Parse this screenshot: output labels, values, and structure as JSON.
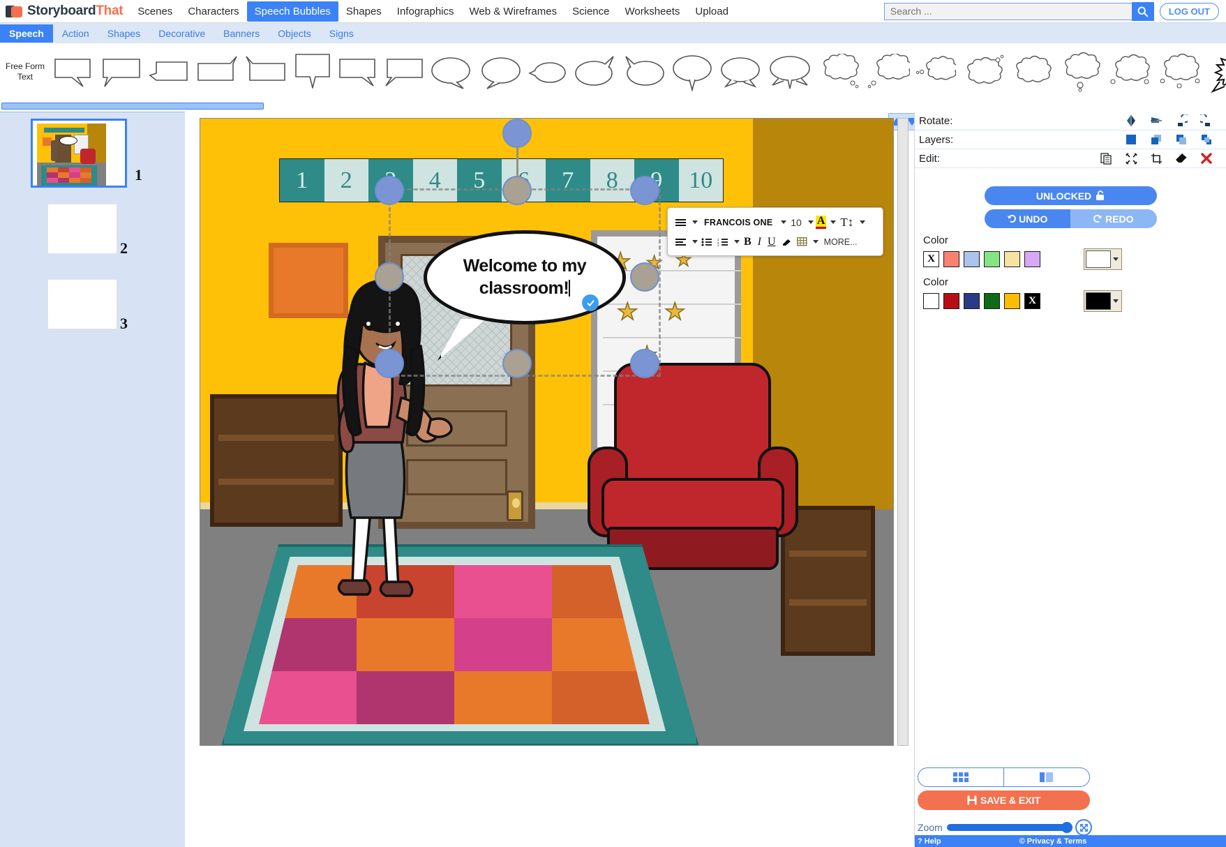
{
  "app": {
    "brand_part1": "Storyboard",
    "brand_part2": "That",
    "logo_icon": "storyboard-logo-icon"
  },
  "topnav": {
    "items": [
      {
        "label": "Scenes",
        "active": false
      },
      {
        "label": "Characters",
        "active": false
      },
      {
        "label": "Speech Bubbles",
        "active": true
      },
      {
        "label": "Shapes",
        "active": false
      },
      {
        "label": "Infographics",
        "active": false
      },
      {
        "label": "Web & Wireframes",
        "active": false
      },
      {
        "label": "Science",
        "active": false
      },
      {
        "label": "Worksheets",
        "active": false
      },
      {
        "label": "Upload",
        "active": false
      }
    ],
    "search_placeholder": "Search ...",
    "search_value": "",
    "search_icon": "search-icon",
    "logout_label": "LOG OUT",
    "active_accent": "#3b82f6"
  },
  "subnav": {
    "items": [
      {
        "label": "Speech",
        "active": true
      },
      {
        "label": "Action",
        "active": false
      },
      {
        "label": "Shapes",
        "active": false
      },
      {
        "label": "Decorative",
        "active": false
      },
      {
        "label": "Banners",
        "active": false
      },
      {
        "label": "Objects",
        "active": false
      },
      {
        "label": "Signs",
        "active": false
      }
    ]
  },
  "palette": {
    "free_form_line1": "Free Form",
    "free_form_line2": "Text",
    "shapes": [
      "rect-tail-right",
      "rect-tail-left",
      "rect-tail-left-point",
      "rect-tail-upright",
      "rect-tail-upleft",
      "rect-tail-down",
      "rect-tail-downright",
      "rect-tail-downleft",
      "oval-tail-downright",
      "oval-tail-downleft",
      "oval-small-left",
      "oval-tail-upright",
      "oval-tail-upleft",
      "oval-tail-down",
      "oval-tail-dual",
      "oval-tail-triple",
      "cloud-dots-right",
      "cloud-dots-left",
      "cloud-small",
      "cloud-dots-up",
      "cloud-plain",
      "cloud-tail-down",
      "cloud-dots-both",
      "cloud-dots-under",
      "starburst"
    ]
  },
  "cells": {
    "items": [
      {
        "number": "1",
        "selected": true,
        "empty": false
      },
      {
        "number": "2",
        "selected": false,
        "empty": true
      },
      {
        "number": "3",
        "selected": false,
        "empty": true
      }
    ]
  },
  "canvas": {
    "scroll_up_icon": "triangle-up-icon",
    "scroll_down_icon": "triangle-down-icon",
    "number_strip": [
      "1",
      "2",
      "3",
      "4",
      "5",
      "6",
      "7",
      "8",
      "9",
      "10"
    ],
    "strip_dark_color": "#2e8b88",
    "strip_light_color": "#cfe3e0",
    "wall_color": "#ffc107",
    "wall_right_color": "#b8860b",
    "floor_color": "#808080",
    "rug_colors": [
      "#e8792a",
      "#c8442e",
      "#e8508f",
      "#d4602a",
      "#b0356f",
      "#e8792a",
      "#d4408a",
      "#e8792a",
      "#e8508f",
      "#b0356f",
      "#e8792a",
      "#d4602a"
    ],
    "chair_color": "#c0272d",
    "selected_object": "speech-bubble-oval"
  },
  "speech_bubble": {
    "text_line1": "Welcome to my",
    "text_line2": "classroom!",
    "confirm_icon": "check-icon",
    "text_color": "#111111",
    "fill_color": "#ffffff"
  },
  "format_toolbar": {
    "align_icon": "align-menu-icon",
    "font_name": "FRANCOIS ONE",
    "font_size": "10",
    "font_color_glyph": "A",
    "font_color_swatch": "#cc0000",
    "font_color_highlight": "#ffe600",
    "line_height_icon": "line-height-icon",
    "paragraph_align_icon": "paragraph-align-icon",
    "bullet_list_icon": "bullet-list-icon",
    "number_list_icon": "numbered-list-icon",
    "bold_label": "B",
    "italic_label": "I",
    "underline_label": "U",
    "highlight_icon": "highlighter-icon",
    "table_icon": "table-icon",
    "more_label": "MORE..."
  },
  "right_panel": {
    "rows": [
      {
        "label": "Rotate:",
        "icons": [
          "flip-horizontal-icon",
          "flip-vertical-icon",
          "rotate-left-icon",
          "rotate-right-icon"
        ]
      },
      {
        "label": "Layers:",
        "icons": [
          "bring-to-front-icon",
          "bring-forward-icon",
          "send-backward-icon",
          "send-to-back-icon"
        ]
      },
      {
        "label": "Edit:",
        "icons": [
          "duplicate-icon",
          "fit-icon",
          "crop-icon",
          "eraser-icon",
          "delete-icon"
        ]
      }
    ],
    "lock_label": "UNLOCKED",
    "lock_icon": "unlock-icon",
    "undo_label": "UNDO",
    "undo_icon": "undo-arrow-icon",
    "redo_label": "REDO",
    "redo_icon": "redo-arrow-icon",
    "color_label_1": "Color",
    "color_label_2": "Color",
    "swatches_1": [
      {
        "color": "#ffffff",
        "glyph": "X",
        "name": "transparent"
      },
      {
        "color": "#fa8072",
        "glyph": "",
        "name": "salmon"
      },
      {
        "color": "#aac4ec",
        "glyph": "",
        "name": "light-blue"
      },
      {
        "color": "#85e585",
        "glyph": "",
        "name": "light-green"
      },
      {
        "color": "#f7e3a1",
        "glyph": "",
        "name": "light-yellow"
      },
      {
        "color": "#d8a8f5",
        "glyph": "",
        "name": "light-purple"
      }
    ],
    "picker_1_color": "#ffffff",
    "swatches_2": [
      {
        "color": "#ffffff",
        "glyph": "",
        "name": "white"
      },
      {
        "color": "#b80d17",
        "glyph": "",
        "name": "red"
      },
      {
        "color": "#2c3b86",
        "glyph": "",
        "name": "navy"
      },
      {
        "color": "#0f6b17",
        "glyph": "",
        "name": "green"
      },
      {
        "color": "#fcbd00",
        "glyph": "",
        "name": "amber"
      },
      {
        "color": "#000000",
        "glyph": "X",
        "name": "transparent-dark"
      }
    ],
    "picker_2_color": "#000000",
    "view_grid_icon": "grid-view-icon",
    "view_panel_icon": "panel-view-icon",
    "save_label": "SAVE & EXIT",
    "save_icon": "floppy-disk-icon",
    "save_color": "#f4714f",
    "zoom_label": "Zoom",
    "zoom_value": "100",
    "fullscreen_icon": "fullscreen-icon",
    "footer_help": "Help",
    "footer_help_icon": "question-mark-icon",
    "footer_privacy": "© Privacy & Terms"
  }
}
